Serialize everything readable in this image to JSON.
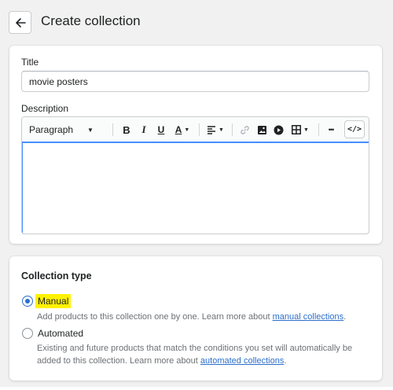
{
  "header": {
    "back_icon": "arrow-left-icon",
    "title": "Create collection"
  },
  "form": {
    "title_label": "Title",
    "title_value": "movie posters",
    "description_label": "Description",
    "toolbar": {
      "paragraph_label": "Paragraph",
      "bold_label": "B",
      "italic_label": "I",
      "underline_label": "U",
      "text_color_label": "A",
      "icons": [
        "bold-icon",
        "italic-icon",
        "underline-icon",
        "text-color-icon",
        "align-icon",
        "link-icon",
        "image-icon",
        "video-icon",
        "table-icon",
        "more-icon",
        "code-view-icon"
      ],
      "more_label": "•••",
      "code_label": "</>"
    },
    "description_value": ""
  },
  "collection_type": {
    "title": "Collection type",
    "options": [
      {
        "label": "Manual",
        "checked": true,
        "help_prefix": "Add products to this collection one by one. Learn more about ",
        "help_link": "manual collections",
        "help_suffix": "."
      },
      {
        "label": "Automated",
        "checked": false,
        "help_prefix": "Existing and future products that match the conditions you set will automatically be added to this collection. Learn more about ",
        "help_link": "automated collections",
        "help_suffix": "."
      }
    ]
  },
  "colors": {
    "accent": "#2c6ecb",
    "focus": "#458fff",
    "highlight": "#fff200",
    "background": "#f1f1f1"
  }
}
